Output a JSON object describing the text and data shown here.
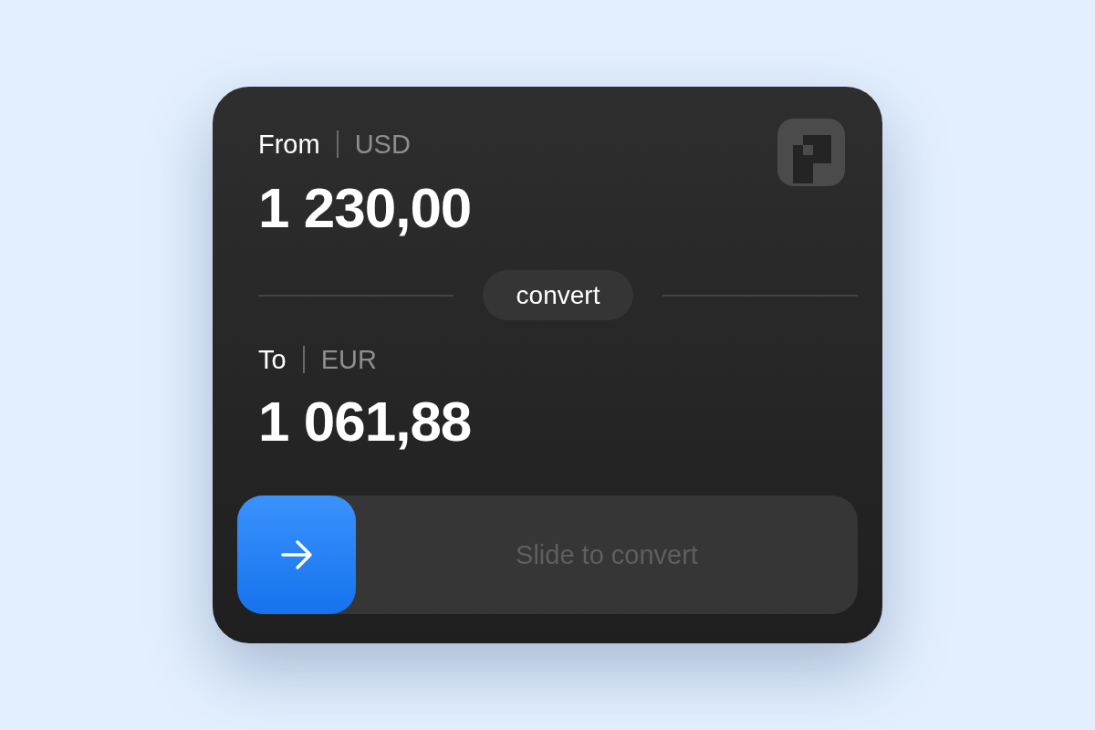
{
  "from": {
    "label": "From",
    "currency": "USD",
    "amount": "1 230,00"
  },
  "convert_button": {
    "label": "convert"
  },
  "to": {
    "label": "To",
    "currency": "EUR",
    "amount": "1 061,88"
  },
  "slider": {
    "label": "Slide to convert",
    "level": 0
  }
}
